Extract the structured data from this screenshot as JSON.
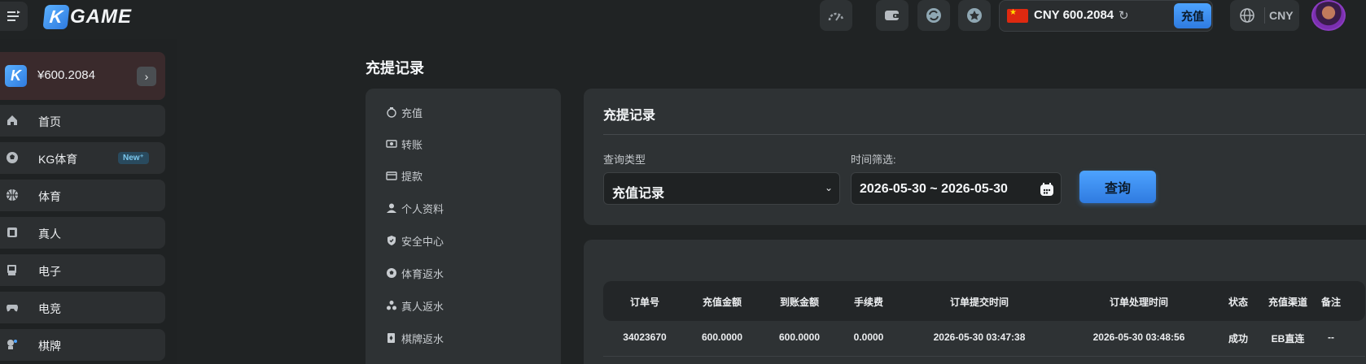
{
  "header": {
    "logo_k": "K",
    "logo_text": "GAME",
    "balance": "CNY 600.2084",
    "recharge_label": "充值",
    "currency": "CNY"
  },
  "sidebar": {
    "wallet_logo": "K",
    "wallet_amount": "¥600.2084",
    "items": [
      {
        "label": "首页",
        "icon": "home-icon"
      },
      {
        "label": "KG体育",
        "icon": "soccer-icon",
        "badge": "New⁺"
      },
      {
        "label": "体育",
        "icon": "basketball-icon"
      },
      {
        "label": "真人",
        "icon": "cards-icon"
      },
      {
        "label": "电子",
        "icon": "slot-machine-icon"
      },
      {
        "label": "电竞",
        "icon": "gamepad-icon"
      },
      {
        "label": "棋牌",
        "icon": "chess-icon"
      }
    ]
  },
  "page": {
    "title": "充提记录"
  },
  "sub_menu": [
    {
      "label": "充值",
      "icon": "piggy-bank-icon"
    },
    {
      "label": "转账",
      "icon": "transfer-icon"
    },
    {
      "label": "提款",
      "icon": "withdraw-icon"
    },
    {
      "label": "个人资料",
      "icon": "user-icon"
    },
    {
      "label": "安全中心",
      "icon": "shield-icon"
    },
    {
      "label": "体育返水",
      "icon": "ball-icon"
    },
    {
      "label": "真人返水",
      "icon": "people-icon"
    },
    {
      "label": "棋牌返水",
      "icon": "card-icon"
    }
  ],
  "query": {
    "title": "充提记录",
    "type_label": "查询类型",
    "type_value": "充值记录",
    "time_label": "时间筛选:",
    "date_range": "2026-05-30 ~ 2026-05-30",
    "query_button": "查询"
  },
  "table": {
    "columns": [
      "订单号",
      "充值金额",
      "到账金额",
      "手续费",
      "订单提交时间",
      "订单处理时间",
      "状态",
      "充值渠道",
      "备注"
    ],
    "rows": [
      [
        "34023670",
        "600.0000",
        "600.0000",
        "0.0000",
        "2026-05-30 03:47:38",
        "2026-05-30 03:48:56",
        "成功",
        "EB直连",
        "--"
      ]
    ]
  },
  "colors": {
    "accent": "#4da3ff",
    "background": "#202324",
    "card": "#2e3234"
  }
}
